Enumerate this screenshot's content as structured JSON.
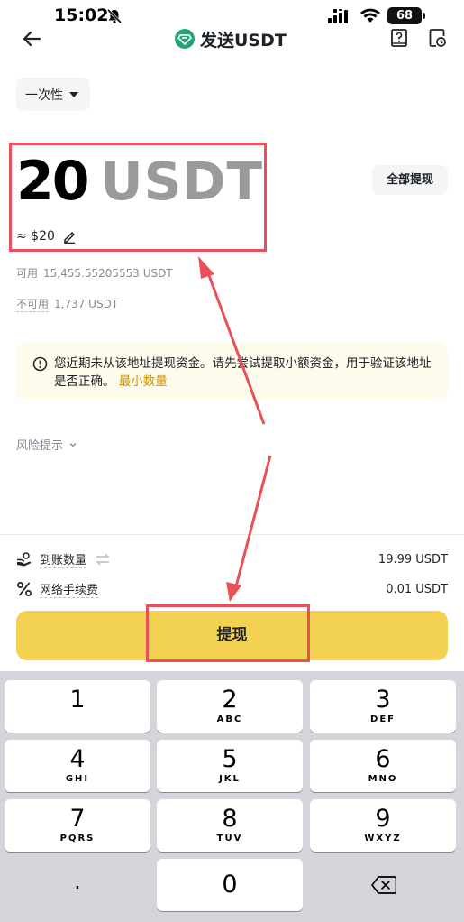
{
  "status_bar": {
    "time": "15:02",
    "battery": "68"
  },
  "header": {
    "title": "发送USDT"
  },
  "type_selector": {
    "label": "一次性"
  },
  "amount": {
    "value": "20",
    "unit": "USDT",
    "approx": "≈ $20"
  },
  "max_button": "全部提现",
  "balances": [
    {
      "label": "可用",
      "value": "15,455.55205553 USDT"
    },
    {
      "label": "不可用",
      "value": "1,737 USDT"
    }
  ],
  "warning": {
    "text": "您近期未从该地址提现资金。请先尝试提取小额资金，用于验证该地址是否正确。",
    "link": "最小数量"
  },
  "risk": {
    "label": "风险提示"
  },
  "receive": {
    "label": "到账数量",
    "value": "19.99 USDT"
  },
  "fee": {
    "label": "网络手续费",
    "value": "0.01 USDT"
  },
  "withdraw_button": "提现",
  "keypad": {
    "k1": {
      "num": "1",
      "letters": ""
    },
    "k2": {
      "num": "2",
      "letters": "ABC"
    },
    "k3": {
      "num": "3",
      "letters": "DEF"
    },
    "k4": {
      "num": "4",
      "letters": "GHI"
    },
    "k5": {
      "num": "5",
      "letters": "JKL"
    },
    "k6": {
      "num": "6",
      "letters": "MNO"
    },
    "k7": {
      "num": "7",
      "letters": "PQRS"
    },
    "k8": {
      "num": "8",
      "letters": "TUV"
    },
    "k9": {
      "num": "9",
      "letters": "WXYZ"
    },
    "k0": {
      "num": "0"
    },
    "dot": "."
  },
  "colors": {
    "accent": "#f2d153",
    "highlight": "#e9505a",
    "link": "#c99400"
  }
}
